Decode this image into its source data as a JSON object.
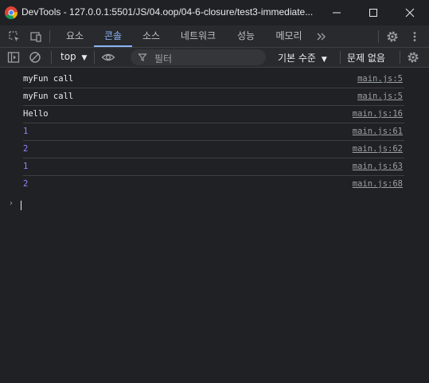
{
  "window": {
    "title": "DevTools - 127.0.0.1:5501/JS/04.oop/04-6-closure/test3-immediate..."
  },
  "tabs": [
    {
      "label": "요소"
    },
    {
      "label": "콘솔",
      "active": true
    },
    {
      "label": "소스"
    },
    {
      "label": "네트워크"
    },
    {
      "label": "성능"
    },
    {
      "label": "메모리"
    }
  ],
  "toolbar": {
    "context": "top",
    "filter_placeholder": "필터",
    "log_level": "기본 수준",
    "issues": "문제 없음"
  },
  "console": {
    "messages": [
      {
        "text": "myFun call",
        "source": "main.js:5",
        "kind": "string"
      },
      {
        "text": "myFun call",
        "source": "main.js:5",
        "kind": "string"
      },
      {
        "text": "Hello",
        "source": "main.js:16",
        "kind": "string"
      },
      {
        "text": "1",
        "source": "main.js:61",
        "kind": "number"
      },
      {
        "text": "2",
        "source": "main.js:62",
        "kind": "number"
      },
      {
        "text": "1",
        "source": "main.js:63",
        "kind": "number"
      },
      {
        "text": "2",
        "source": "main.js:68",
        "kind": "number"
      }
    ]
  },
  "colors": {
    "background": "#202124",
    "accent": "#8ab4f8",
    "number": "#9980ff"
  },
  "icons": [
    "chrome-logo-icon",
    "inspect-element-icon",
    "device-toolbar-icon",
    "more-tabs-icon",
    "settings-icon",
    "kebab-menu-icon",
    "sidebar-toggle-icon",
    "clear-console-icon",
    "eye-icon",
    "filter-icon",
    "console-settings-icon",
    "prompt-chevron-icon"
  ]
}
